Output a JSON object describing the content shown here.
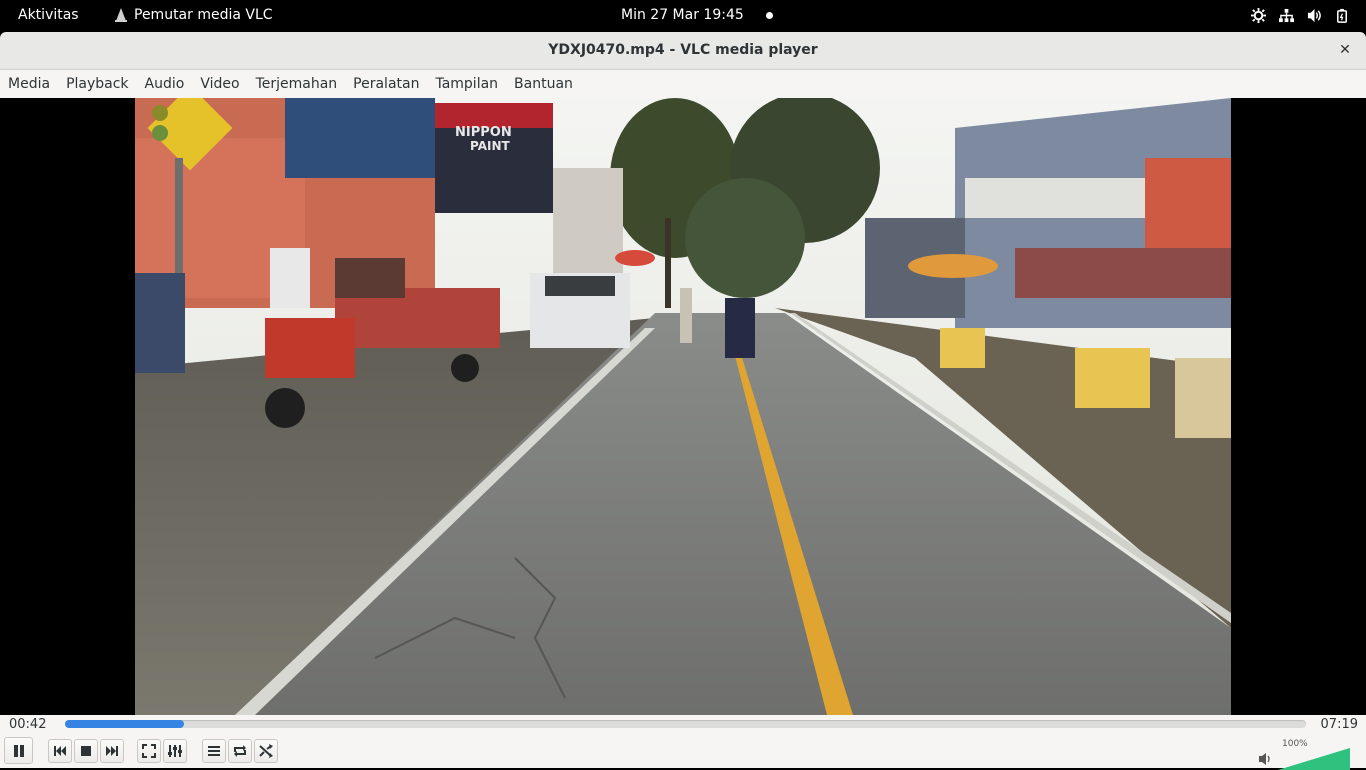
{
  "topbar": {
    "activities": "Aktivitas",
    "app_name": "Pemutar media VLC",
    "clock": "Min 27 Mar  19:45",
    "tray_icons": [
      "accessibility-icon",
      "network-icon",
      "volume-icon",
      "power-icon"
    ]
  },
  "window": {
    "title": "YDXJ0470.mp4 - VLC media player",
    "close_glyph": "✕"
  },
  "menu": [
    "Media",
    "Playback",
    "Audio",
    "Video",
    "Terjemahan",
    "Peralatan",
    "Tampilan",
    "Bantuan"
  ],
  "player": {
    "elapsed": "00:42",
    "total": "07:19",
    "progress_fraction": 0.096,
    "volume_label": "100%",
    "volume_fraction": 1.0
  },
  "controls": {
    "buttons": [
      "pause",
      "previous",
      "stop",
      "next",
      "fullscreen",
      "extended-settings",
      "playlist",
      "loop",
      "shuffle"
    ]
  },
  "colors": {
    "accent": "#3584e4",
    "volume_green": "#2ec27e"
  }
}
